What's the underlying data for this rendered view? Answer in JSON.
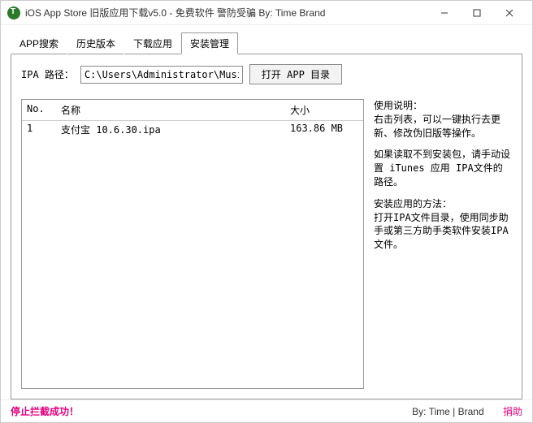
{
  "window": {
    "title": "iOS App Store 旧版应用下载v5.0 - 免费软件 警防受骗 By: Time Brand"
  },
  "tabs": [
    {
      "label": "APP搜索"
    },
    {
      "label": "历史版本"
    },
    {
      "label": "下载应用"
    },
    {
      "label": "安装管理"
    }
  ],
  "path_row": {
    "label": "IPA 路径：",
    "value": "C:\\Users\\Administrator\\Music\\",
    "button": "打开 APP 目录"
  },
  "list": {
    "head_no": "No.",
    "head_name": "名称",
    "head_size": "大小",
    "rows": [
      {
        "no": "1",
        "name": "支付宝 10.6.30.ipa",
        "size": "163.86 MB"
      }
    ]
  },
  "help": {
    "p1": "使用说明：\n右击列表，可以一键执行去更新、修改伪旧版等操作。",
    "p2": "如果读取不到安装包，请手动设置 iTunes 应用 IPA文件的路径。",
    "p3": "安装应用的方法：\n打开IPA文件目录，使用同步助手或第三方助手类软件安装IPA文件。"
  },
  "status": {
    "left": "停止拦截成功！",
    "right": "By: Time | Brand",
    "donate": "捐助"
  }
}
